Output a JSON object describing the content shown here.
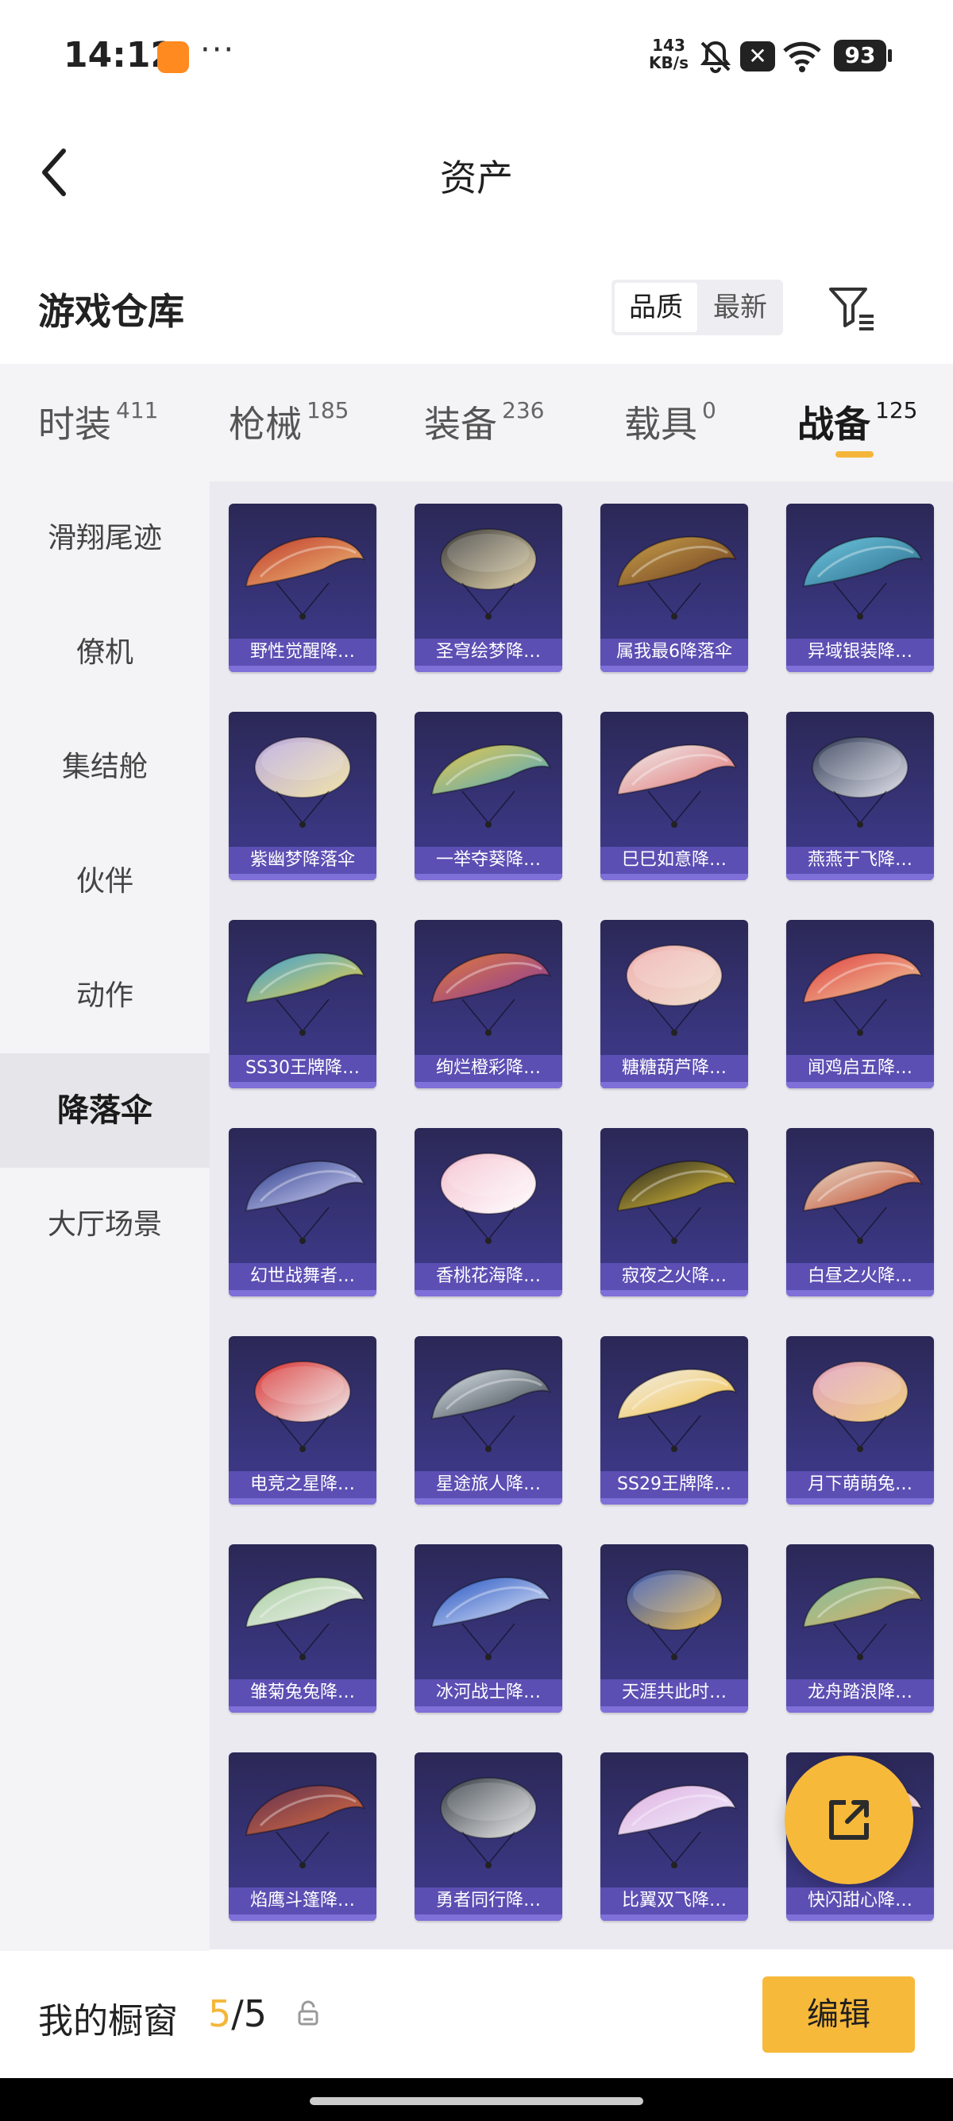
{
  "status_bar": {
    "time": "14:12",
    "speed_value": "143",
    "speed_unit": "KB/s",
    "battery": "93",
    "icons": [
      "app-notification-icon",
      "mute-icon",
      "close-notification-icon",
      "wifi-icon",
      "battery-icon"
    ]
  },
  "nav": {
    "title": "资产",
    "back_icon": "back-chevron-icon"
  },
  "header": {
    "title": "游戏仓库",
    "sort_options": [
      "品质",
      "最新"
    ],
    "sort_selected": "品质",
    "filter_icon": "filter-icon"
  },
  "tabs": [
    {
      "label": "时装",
      "count": "411"
    },
    {
      "label": "枪械",
      "count": "185"
    },
    {
      "label": "装备",
      "count": "236"
    },
    {
      "label": "载具",
      "count": "0"
    },
    {
      "label": "战备",
      "count": "125"
    }
  ],
  "active_tab": "战备",
  "sidebar": {
    "items": [
      "滑翔尾迹",
      "僚机",
      "集结舱",
      "伙伴",
      "动作",
      "降落伞",
      "大厅场景"
    ],
    "selected": "降落伞"
  },
  "items": [
    "野性觉醒降…",
    "圣穹绘梦降…",
    "属我最6降落伞",
    "异域银装降…",
    "紫幽梦降落伞",
    "一举夺葵降…",
    "巳巳如意降…",
    "燕燕于飞降…",
    "SS30王牌降…",
    "绚烂橙彩降…",
    "糖糖葫芦降…",
    "闻鸡启五降…",
    "幻世战舞者…",
    "香桃花海降…",
    "寂夜之火降…",
    "白昼之火降…",
    "电竞之星降…",
    "星途旅人降…",
    "SS29王牌降…",
    "月下萌萌兔…",
    "雏菊兔兔降…",
    "冰河战士降…",
    "天涯共此时…",
    "龙舟踏浪降…",
    "焰鹰斗篷降…",
    "勇者同行降…",
    "比翼双飞降…",
    "快闪甜心降…"
  ],
  "fab_icon": "share-external-icon",
  "bottom": {
    "showcase_label": "我的橱窗",
    "showcase_current": "5",
    "showcase_total": "/5",
    "edit_label": "编辑"
  },
  "colors": {
    "accent": "#f7b93a",
    "card_bg": "#3a3680",
    "card_label": "#5b4fb3",
    "panel_bg": "#f4f4f6"
  }
}
